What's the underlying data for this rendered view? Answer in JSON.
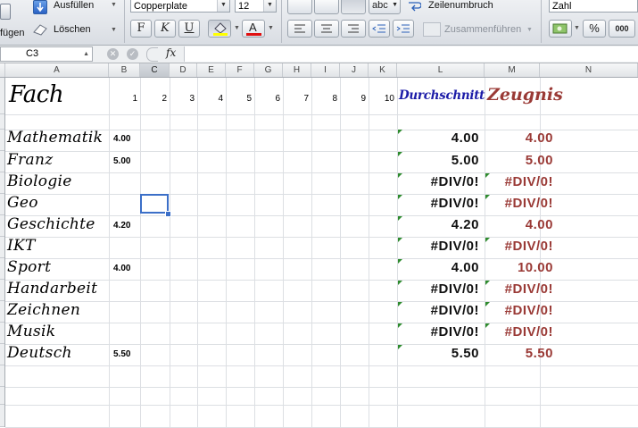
{
  "ribbon": {
    "fill_label": "Ausfüllen",
    "clear_label": "Löschen",
    "paste_label_fragment": "fügen",
    "font_name": "Copperplate",
    "font_size": "12",
    "bold_label": "F",
    "italic_label": "K",
    "underline_label": "U",
    "orientation_label": "abc",
    "wrap_label": "Zeilenumbruch",
    "merge_label": "Zusammenführen",
    "number_format": "Zahl",
    "percent_label": "%",
    "thousands_label": "000"
  },
  "formula_bar": {
    "name_box": "C3",
    "fx_label": "fx",
    "formula": ""
  },
  "columns": [
    "A",
    "B",
    "C",
    "D",
    "E",
    "F",
    "G",
    "H",
    "I",
    "J",
    "K",
    "L",
    "M",
    "N"
  ],
  "selected_column": "C",
  "selected_cell": "C3",
  "header_row": {
    "subject_title": "Fach",
    "numbers": [
      "1",
      "2",
      "3",
      "4",
      "5",
      "6",
      "7",
      "8",
      "9",
      "10"
    ],
    "average_title": "Durchschnitt",
    "report_title": "Zeugnis"
  },
  "rows": [
    {
      "subject": "Mathematik",
      "grade": "4.00",
      "average": "4.00",
      "report": "4.00"
    },
    {
      "subject": "Franz",
      "grade": "5.00",
      "average": "5.00",
      "report": "5.00"
    },
    {
      "subject": "Biologie",
      "grade": "",
      "average": "#DIV/0!",
      "report": "#DIV/0!"
    },
    {
      "subject": "Geo",
      "grade": "",
      "average": "#DIV/0!",
      "report": "#DIV/0!"
    },
    {
      "subject": "Geschichte",
      "grade": "4.20",
      "average": "4.20",
      "report": "4.00"
    },
    {
      "subject": "IKT",
      "grade": "",
      "average": "#DIV/0!",
      "report": "#DIV/0!"
    },
    {
      "subject": "Sport",
      "grade": "4.00",
      "average": "4.00",
      "report": "10.00"
    },
    {
      "subject": "Handarbeit",
      "grade": "",
      "average": "#DIV/0!",
      "report": "#DIV/0!"
    },
    {
      "subject": "Zeichnen",
      "grade": "",
      "average": "#DIV/0!",
      "report": "#DIV/0!"
    },
    {
      "subject": "Musik",
      "grade": "",
      "average": "#DIV/0!",
      "report": "#DIV/0!"
    },
    {
      "subject": "Deutsch",
      "grade": "5.50",
      "average": "5.50",
      "report": "5.50"
    }
  ],
  "colors": {
    "average_title": "#1c1ca8",
    "report_title": "#9a3a36",
    "report_values": "#9a3a36",
    "selection": "#3b6fc8",
    "comment_marker": "#2e8b2e"
  }
}
